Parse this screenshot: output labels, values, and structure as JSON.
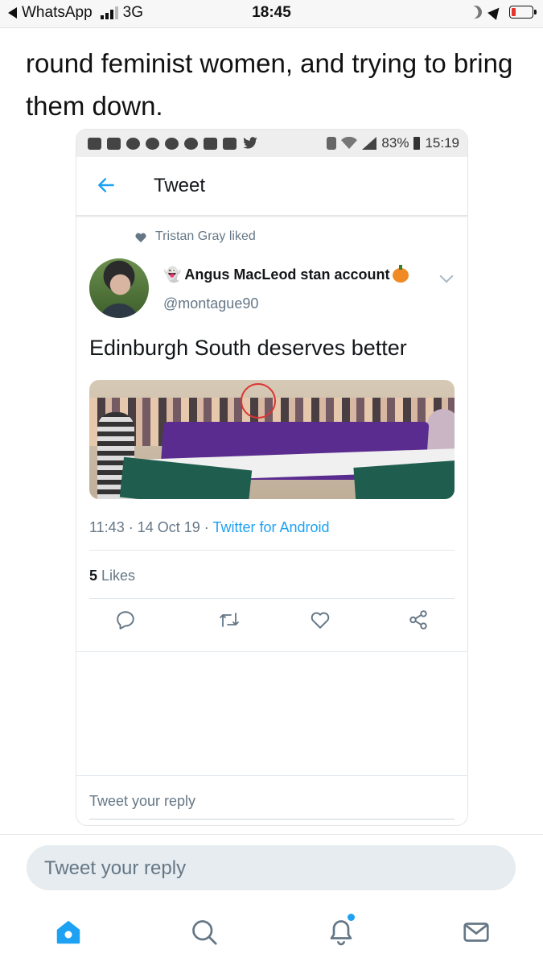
{
  "ios_status": {
    "back_app": "WhatsApp",
    "network": "3G",
    "time": "18:45"
  },
  "intro_text": "round feminist women, and trying to bring them down.",
  "android": {
    "status": {
      "battery": "83%",
      "time": "15:19"
    },
    "header": {
      "title": "Tweet"
    },
    "liked_by": "Tristan Gray liked",
    "author": {
      "display_name": "Angus MacLeod stan account",
      "handle": "@montague90"
    },
    "tweet_text": "Edinburgh South deserves better",
    "meta": {
      "time": "11:43",
      "date": "14 Oct 19",
      "source": "Twitter for Android"
    },
    "likes": {
      "count": "5",
      "label": "Likes"
    },
    "reply_placeholder": "Tweet your reply"
  },
  "outer_reply_placeholder": "Tweet your reply",
  "colors": {
    "twitter_blue": "#1da1f2",
    "banner_purple": "#5b2c8f"
  }
}
